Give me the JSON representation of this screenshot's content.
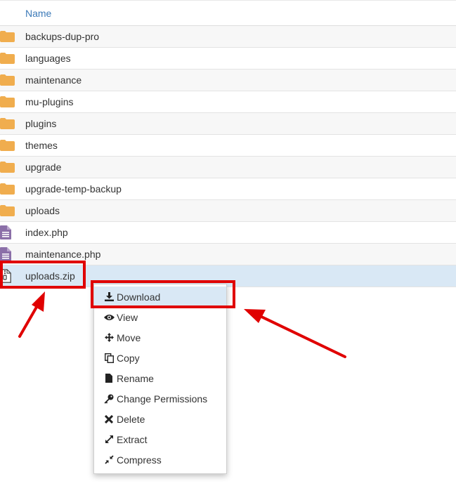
{
  "header": {
    "name_label": "Name"
  },
  "rows": [
    {
      "name": "backups-dup-pro",
      "kind": "folder-icon"
    },
    {
      "name": "languages",
      "kind": "folder-icon"
    },
    {
      "name": "maintenance",
      "kind": "folder-icon"
    },
    {
      "name": "mu-plugins",
      "kind": "folder-icon"
    },
    {
      "name": "plugins",
      "kind": "folder-icon"
    },
    {
      "name": "themes",
      "kind": "folder-icon"
    },
    {
      "name": "upgrade",
      "kind": "folder-icon"
    },
    {
      "name": "upgrade-temp-backup",
      "kind": "folder-icon"
    },
    {
      "name": "uploads",
      "kind": "folder-icon"
    },
    {
      "name": "index.php",
      "kind": "php-file-icon"
    },
    {
      "name": "maintenance.php",
      "kind": "php-file-icon"
    },
    {
      "name": "uploads.zip",
      "kind": "zip-file-icon",
      "selected": true
    }
  ],
  "context_menu": {
    "items": [
      {
        "label": "Download",
        "icon": "download-icon",
        "active": true
      },
      {
        "label": "View",
        "icon": "eye-icon"
      },
      {
        "label": "Move",
        "icon": "move-icon"
      },
      {
        "label": "Copy",
        "icon": "copy-icon"
      },
      {
        "label": "Rename",
        "icon": "file-icon"
      },
      {
        "label": "Change Permissions",
        "icon": "key-icon"
      },
      {
        "label": "Delete",
        "icon": "close-icon"
      },
      {
        "label": "Extract",
        "icon": "expand-icon"
      },
      {
        "label": "Compress",
        "icon": "compress-icon"
      }
    ]
  },
  "colors": {
    "folder": "#f0ad4e",
    "php_file": "#8b6fa8",
    "link": "#3c7ab8",
    "selected_row": "#d9e8f5",
    "annotation": "#e00000"
  }
}
